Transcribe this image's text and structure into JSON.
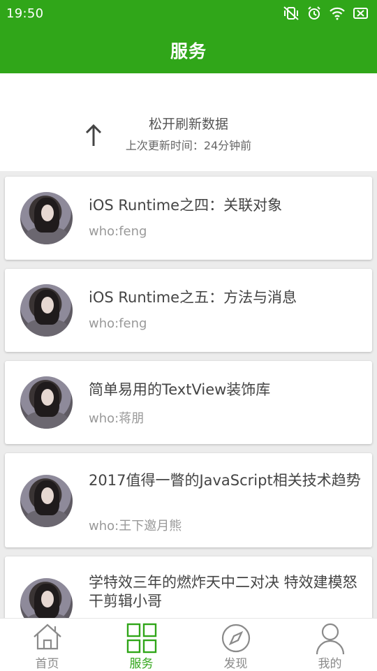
{
  "status_bar": {
    "time": "19:50"
  },
  "header": {
    "title": "服务"
  },
  "refresh": {
    "message": "松开刷新数据",
    "last_updated": "上次更新时间：24分钟前"
  },
  "articles": [
    {
      "title": "iOS Runtime之四：关联对象",
      "author": "who:feng"
    },
    {
      "title": "iOS Runtime之五：方法与消息",
      "author": "who:feng"
    },
    {
      "title": "简单易用的TextView装饰库",
      "author": "who:蒋朋"
    },
    {
      "title": "2017值得一瞥的JavaScript相关技术趋势",
      "author": "who:王下邀月熊"
    },
    {
      "title": "学特效三年的燃炸天中二对决 特效建模怒干剪辑小哥",
      "author": ""
    }
  ],
  "tabs": [
    {
      "label": "首页",
      "icon": "home-icon",
      "active": false
    },
    {
      "label": "服务",
      "icon": "grid-icon",
      "active": true
    },
    {
      "label": "发现",
      "icon": "compass-icon",
      "active": false
    },
    {
      "label": "我的",
      "icon": "person-icon",
      "active": false
    }
  ],
  "colors": {
    "primary": "#30a619",
    "tab_inactive": "#8a8a8a",
    "text": "#444444",
    "subtext": "#999999"
  }
}
